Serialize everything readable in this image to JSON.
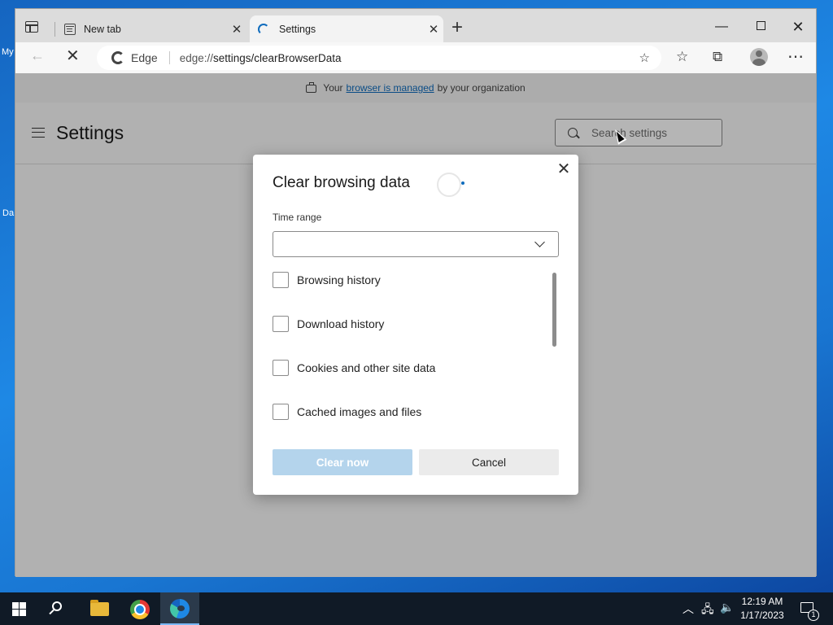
{
  "desktop": {
    "fragments": [
      "My",
      "Da"
    ]
  },
  "browser": {
    "tabs": [
      {
        "title": "New tab",
        "icon": "page-icon"
      },
      {
        "title": "Settings",
        "icon": "loading-spinner-icon"
      }
    ],
    "address_bar": {
      "site_label": "Edge",
      "url_prefix": "edge://",
      "url_path": "settings/clearBrowserData"
    }
  },
  "page": {
    "managed_notice": {
      "before": "Your",
      "link": "browser is managed",
      "after": "by your organization"
    },
    "settings_title": "Settings",
    "search_placeholder": "Search settings"
  },
  "dialog": {
    "title": "Clear browsing data",
    "time_range_label": "Time range",
    "time_range_value": "",
    "options": [
      {
        "label": "Browsing history",
        "checked": false
      },
      {
        "label": "Download history",
        "checked": false
      },
      {
        "label": "Cookies and other site data",
        "checked": false
      },
      {
        "label": "Cached images and files",
        "checked": false
      }
    ],
    "clear_button": "Clear now",
    "cancel_button": "Cancel"
  },
  "taskbar": {
    "time": "12:19 AM",
    "date": "1/17/2023",
    "notification_count": "1"
  },
  "colors": {
    "accent": "#0f6cbd",
    "desktop": "#1976d2",
    "taskbar": "#101a26"
  }
}
